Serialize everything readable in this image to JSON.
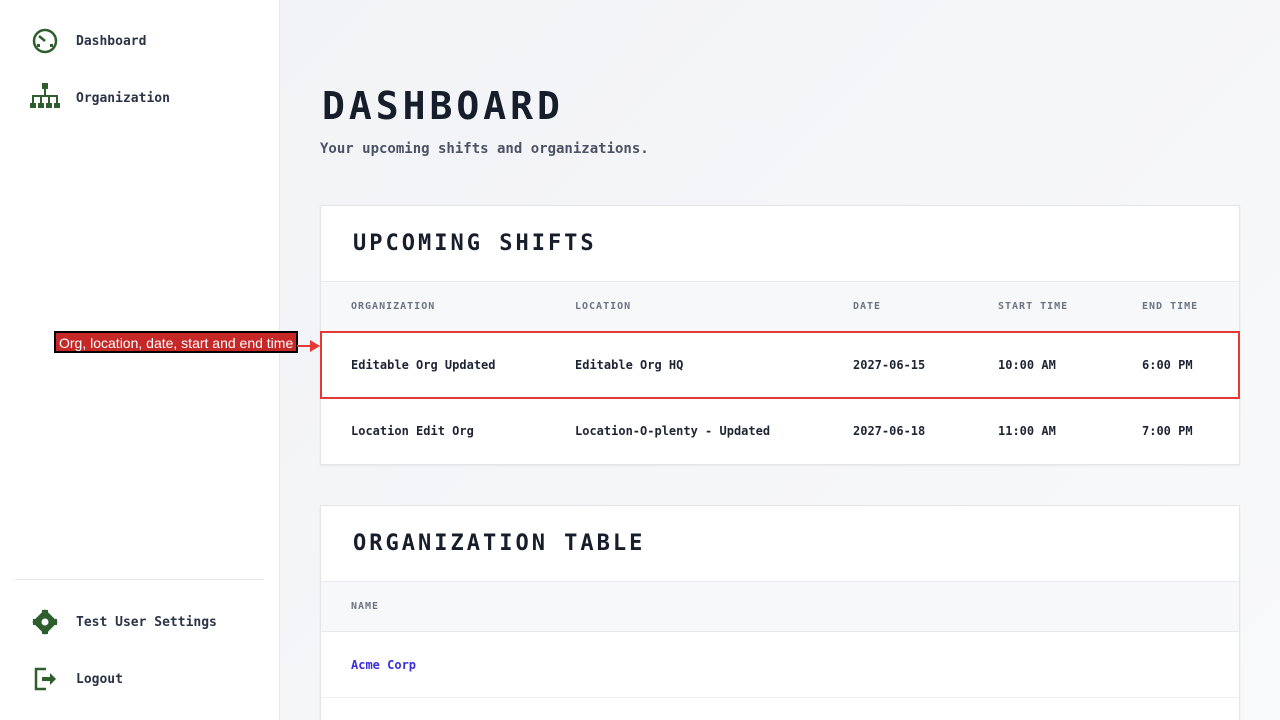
{
  "sidebar": {
    "items": [
      {
        "label": "Dashboard",
        "icon": "dashboard-icon"
      },
      {
        "label": "Organization",
        "icon": "org-chart-icon"
      }
    ],
    "bottom_items": [
      {
        "label": "Test User Settings",
        "icon": "gear-icon"
      },
      {
        "label": "Logout",
        "icon": "logout-icon"
      }
    ]
  },
  "main": {
    "title": "DASHBOARD",
    "subtitle": "Your upcoming shifts and organizations.",
    "shifts": {
      "title": "UPCOMING SHIFTS",
      "columns": [
        "ORGANIZATION",
        "LOCATION",
        "DATE",
        "START TIME",
        "END TIME"
      ],
      "rows": [
        [
          "Editable Org Updated",
          "Editable Org HQ",
          "2027-06-15",
          "10:00 AM",
          "6:00 PM"
        ],
        [
          "Location Edit Org",
          "Location-O-plenty - Updated",
          "2027-06-18",
          "11:00 AM",
          "7:00 PM"
        ]
      ]
    },
    "orgs": {
      "title": "ORGANIZATION TABLE",
      "columns": [
        "NAME"
      ],
      "rows": [
        [
          "Acme Corp"
        ]
      ]
    }
  },
  "annotation": {
    "label": "Org, location, date, start and end time"
  },
  "colors": {
    "icon_green": "#2e5e2e",
    "link": "#3b2fd9",
    "highlight": "#e53935"
  }
}
